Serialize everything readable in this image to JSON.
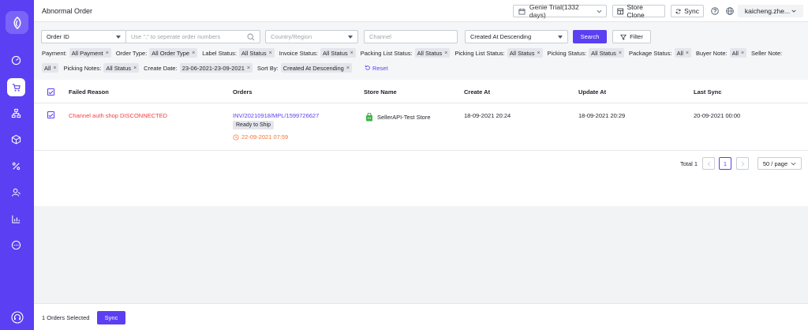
{
  "header": {
    "title": "Abnormal Order",
    "trial_label": "Genie Trial(1332 days)",
    "store_clone_label": "Store Clone",
    "sync_label": "Sync",
    "user_label": "kaicheng.zhe..."
  },
  "filters": {
    "search_field": "Order ID",
    "search_placeholder": "Use \",\" to seperate order numbers",
    "country_placeholder": "Country/Region",
    "channel_placeholder": "Channel",
    "sort_value": "Created At Descending",
    "search_button": "Search",
    "filter_button": "Filter",
    "row1": [
      {
        "label": "Payment:",
        "value": "All Payment"
      },
      {
        "label": "Order Type:",
        "value": "All Order Type"
      },
      {
        "label": "Label Status:",
        "value": "All Status"
      },
      {
        "label": "Invoice Status:",
        "value": "All Status"
      },
      {
        "label": "Packing List Status:",
        "value": "All Status"
      },
      {
        "label": "Picking List Status:",
        "value": "All Status"
      },
      {
        "label": "Picking Status:",
        "value": "All Status"
      },
      {
        "label": "Package Status:",
        "value": "All"
      },
      {
        "label": "Buyer Note:",
        "value": "All"
      },
      {
        "label": "Seller Note:",
        "value": ""
      }
    ],
    "row2": [
      {
        "label": "",
        "value": "All"
      },
      {
        "label": "Picking Notes:",
        "value": "All Status"
      },
      {
        "label": "Create Date:",
        "value": "23-06-2021-23-09-2021"
      },
      {
        "label": "Sort By:",
        "value": "Created At Descending"
      }
    ],
    "reset_label": "Reset"
  },
  "table": {
    "columns": [
      "Failed Reason",
      "Orders",
      "Store Name",
      "Create At",
      "Update At",
      "Last Sync"
    ],
    "rows": [
      {
        "failed_reason": "Channel auth shop DISCONNECTED",
        "order_no": "INV/20210918/MPL/1599726627",
        "status": "Ready to Ship",
        "deadline": "22-09-2021 07:59",
        "store": "SellerAPI-Test Store",
        "create_at": "18-09-2021 20:24",
        "update_at": "18-09-2021 20:29",
        "last_sync": "20-09-2021 00:00"
      }
    ]
  },
  "pagination": {
    "total": "Total 1",
    "current_page": "1",
    "per_page": "50 / page"
  },
  "bottom": {
    "selected_text": "1 Orders Selected",
    "sync_button": "Sync"
  },
  "colors": {
    "primary": "#5b3ff2",
    "error": "#f53f3f",
    "warning": "#f77234"
  }
}
